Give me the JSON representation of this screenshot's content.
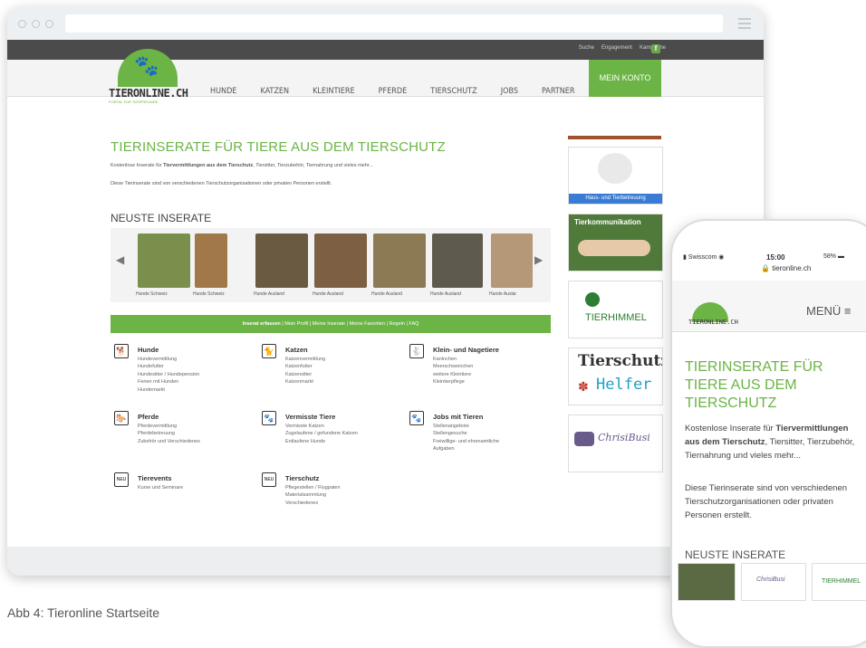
{
  "browser": {
    "top_links": [
      "Suche",
      "Engagement",
      "Kampagne"
    ],
    "fb": "f"
  },
  "site": {
    "logo_text": "TIERONLINE.CH",
    "logo_sub": "PORTAL FÜR TIERFREUNDE",
    "nav": [
      "HUNDE",
      "KATZEN",
      "KLEINTIERE",
      "PFERDE",
      "TIERSCHUTZ",
      "JOBS",
      "PARTNER"
    ],
    "account": "MEIN KONTO",
    "title": "TIERINSERATE FÜR TIERE AUS DEM TIERSCHUTZ",
    "intro1_pre": "Kostenlose Inserate für ",
    "intro1_bold": "Tiervermittlungen aus dem Tierschutz",
    "intro1_post": ", Tiersitter, Tierzubehör, Tiernahrung und vieles mehr...",
    "intro2": "Diese Tierinserate sind von verschiedenen Tierschutzorganisationen oder privaten Personen erstellt.",
    "latest_heading": "NEUSTE INSERATE",
    "carousel": [
      {
        "label": "Hunde Schweiz",
        "color": "#7a8f4c"
      },
      {
        "label": "Hunde Schweiz",
        "color": "#a0784a"
      },
      {
        "label": "Hunde Ausland",
        "color": "#6b5a42"
      },
      {
        "label": "Hunde Ausland",
        "color": "#7d6044"
      },
      {
        "label": "Hunde Ausland",
        "color": "#8c7a54"
      },
      {
        "label": "Hunde Ausland",
        "color": "#5f5a4e"
      },
      {
        "label": "Hunde Auslar",
        "color": "#b49878"
      }
    ],
    "action_bar_bold": "Inserat erfassen",
    "action_bar_rest": " | Mein Profil | Meine Inserate | Meine Favoriten | Regeln | FAQ",
    "categories": [
      {
        "title": "Hunde",
        "items": [
          "Hundevermittlung",
          "Hundefutter",
          "Hundesitter / Hundepension",
          "Ferien mit Hunden",
          "Hundemarkt"
        ],
        "icon": "dog-icon"
      },
      {
        "title": "Katzen",
        "items": [
          "Katzenvermittlung",
          "Katzenfutter",
          "Katzensitter",
          "Katzenmarkt"
        ],
        "icon": "cat-icon"
      },
      {
        "title": "Klein- und Nagetiere",
        "items": [
          "Kaninchen",
          "Meerschweinchen",
          "weitere Kleintiere",
          "Kleintierpflege"
        ],
        "icon": "rabbit-icon"
      },
      {
        "title": "Pferde",
        "items": [
          "Pferdevermittlung",
          "Pferdebetreuung",
          "Zubehör und Verschiedenes"
        ],
        "icon": "horse-icon"
      },
      {
        "title": "Vermisste Tiere",
        "items": [
          "Vermisste Katzen",
          "Zugelaufene / gefundene Katzen",
          "Entlaufene Hunde"
        ],
        "icon": "paw-icon"
      },
      {
        "title": "Jobs mit Tieren",
        "items": [
          "Stellenangebote",
          "Stellengesuche",
          "Freiwillige- und ehrenamtliche",
          "Aufgaben"
        ],
        "icon": "jobs-icon"
      },
      {
        "title": "Tierevents",
        "items": [
          "Kurse und Seminare"
        ],
        "icon": "new-badge-icon"
      },
      {
        "title": "Tierschutz",
        "items": [
          "Pflegestellen / Flugpaten",
          "Materialsammlung",
          "Verschiedenes"
        ],
        "icon": "new-badge-icon"
      }
    ],
    "sidebar": {
      "ad1_label": "Haus- und Tierbetreuung",
      "ad2_label": "Tierkommunikation",
      "ad3_label": "TIERHIMMEL",
      "ad4_line1": "Tierschutz",
      "ad4_line2": "Helfer",
      "ad5_label": "ChrisiBusi"
    },
    "icon_new": "NEU"
  },
  "phone": {
    "carrier": "Swisscom",
    "time": "15:00",
    "battery": "58%",
    "url": "tieronline.ch",
    "logo_text": "TIERONLINE.CH",
    "menu": "MENÜ ≡",
    "title": "TIERINSERATE FÜR TIERE AUS DEM TIERSCHUTZ",
    "text1_pre": "Kostenlose Inserate für ",
    "text1_bold": "Tiervermittlungen aus dem Tierschutz",
    "text1_post": ", Tiersitter, Tierzubehör, Tiernahrung und vieles mehr...",
    "text2": "Diese Tierinserate sind von verschiedenen Tierschutzorganisationen oder privaten Personen erstellt.",
    "latest": "NEUSTE INSERATE",
    "ad_chrisi": "ChrisiBusi",
    "ad_tierhimmel": "TIERHIMMEL"
  },
  "caption": "Abb 4: Tieronline Startseite",
  "colors": {
    "green": "#6bb445",
    "dark": "#4b4b4b"
  }
}
